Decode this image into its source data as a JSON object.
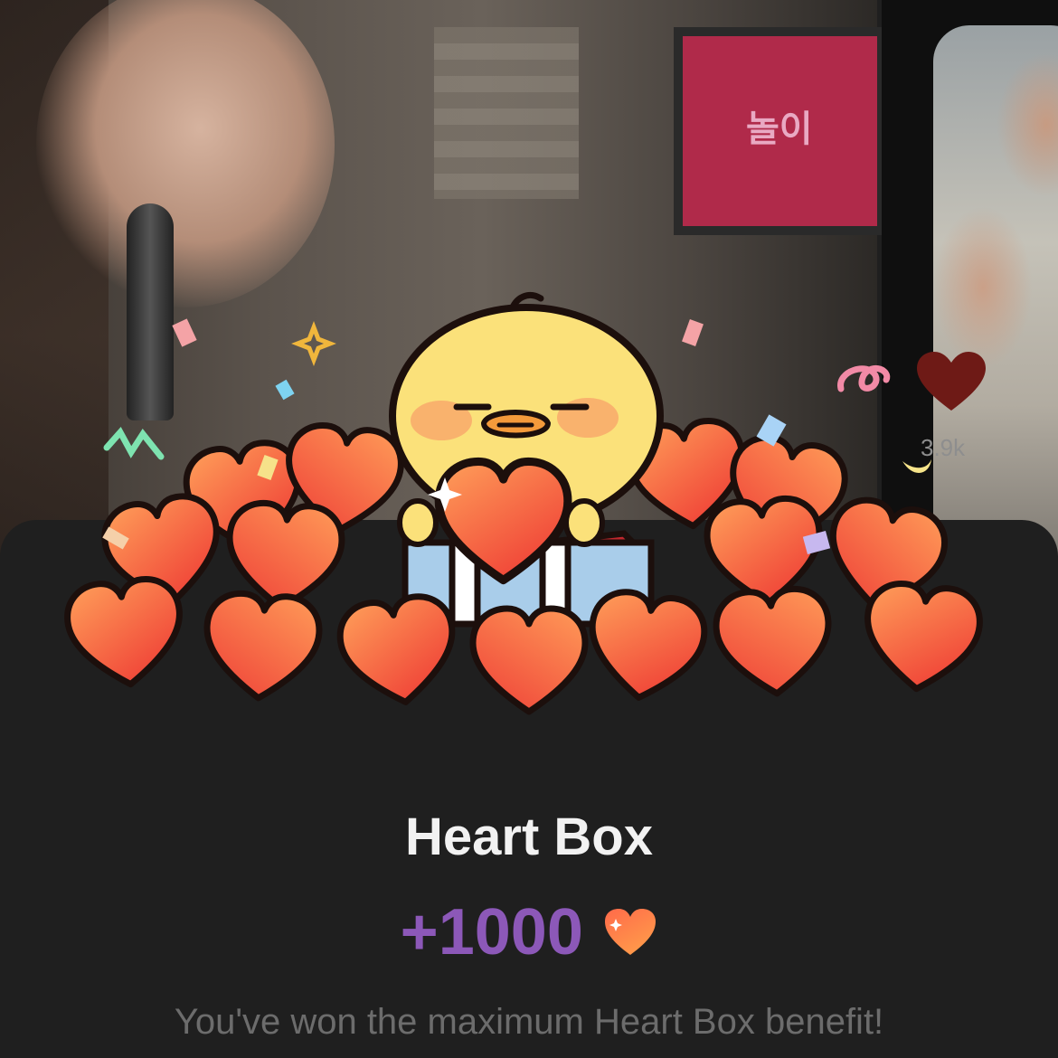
{
  "background": {
    "tv_text": "놀이",
    "like_count": "3.9k"
  },
  "sheet": {
    "title": "Heart Box",
    "amount": "+1000",
    "message": "You've won the maximum Heart Box benefit!"
  },
  "colors": {
    "amount": "#8c58b8",
    "heart_top": "#ff9a55",
    "heart_bottom": "#f0463c",
    "sheet_bg": "#1f1f1f"
  },
  "icons": {
    "like": "heart-icon",
    "reward": "heart-icon",
    "mascot": "chick-character"
  }
}
